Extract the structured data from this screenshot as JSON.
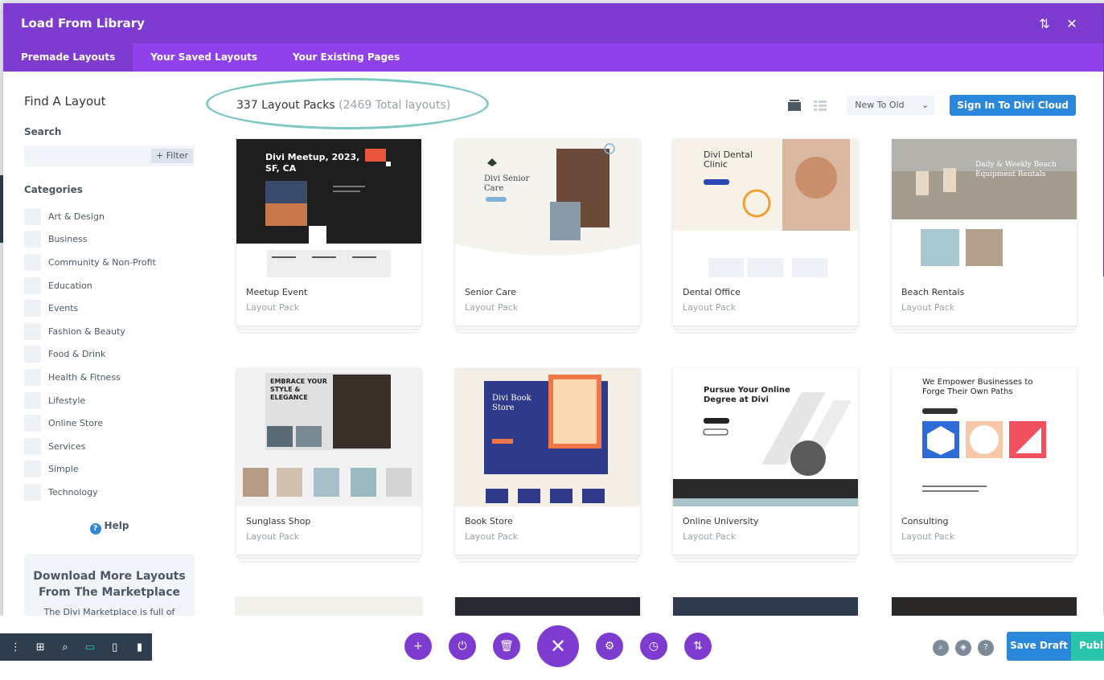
{
  "modal": {
    "title": "Load From Library",
    "tabs": [
      "Premade Layouts",
      "Your Saved Layouts",
      "Your Existing Pages"
    ]
  },
  "sidebar": {
    "find_title": "Find A Layout",
    "search_label": "Search",
    "search_value": "",
    "filter_label": "+ Filter",
    "categories_label": "Categories",
    "categories": [
      "Art & Design",
      "Business",
      "Community & Non-Profit",
      "Education",
      "Events",
      "Fashion & Beauty",
      "Food & Drink",
      "Health & Fitness",
      "Lifestyle",
      "Online Store",
      "Services",
      "Simple",
      "Technology"
    ],
    "help_label": "Help",
    "marketplace_title": "Download More Layouts From The Marketplace",
    "marketplace_text": "The Divi Marketplace is full of"
  },
  "header": {
    "count_text": "337 Layout Packs",
    "total_text": "(2469 Total layouts)",
    "sort_value": "New To Old",
    "cloud_button": "Sign In To Divi Cloud"
  },
  "cards": [
    {
      "name": "Meetup Event",
      "sub": "Layout Pack",
      "thumb_title": "Divi Meetup, 2023, SF, CA"
    },
    {
      "name": "Senior Care",
      "sub": "Layout Pack",
      "thumb_title": "Divi Senior Care"
    },
    {
      "name": "Dental Office",
      "sub": "Layout Pack",
      "thumb_title": "Divi Dental Clinic"
    },
    {
      "name": "Beach Rentals",
      "sub": "Layout Pack",
      "thumb_title": "Daily & Weekly Beach Equipment Rentals"
    },
    {
      "name": "Sunglass Shop",
      "sub": "Layout Pack",
      "thumb_title": "EMBRACE YOUR STYLE & ELEGANCE"
    },
    {
      "name": "Book Store",
      "sub": "Layout Pack",
      "thumb_title": "Divi Book Store"
    },
    {
      "name": "Online University",
      "sub": "Layout Pack",
      "thumb_title": "Pursue Your Online Degree at Divi"
    },
    {
      "name": "Consulting",
      "sub": "Layout Pack",
      "thumb_title": "We Empower Businesses to Forge Their Own Paths"
    }
  ],
  "bottom": {
    "save_draft": "Save Draft",
    "publish": "Publish"
  },
  "colors": {
    "header_purple": "#7e3bd0",
    "tab_purple": "#8f42ec",
    "blue": "#2b87da",
    "teal": "#29c4a9",
    "dark": "#2e3e4e"
  }
}
